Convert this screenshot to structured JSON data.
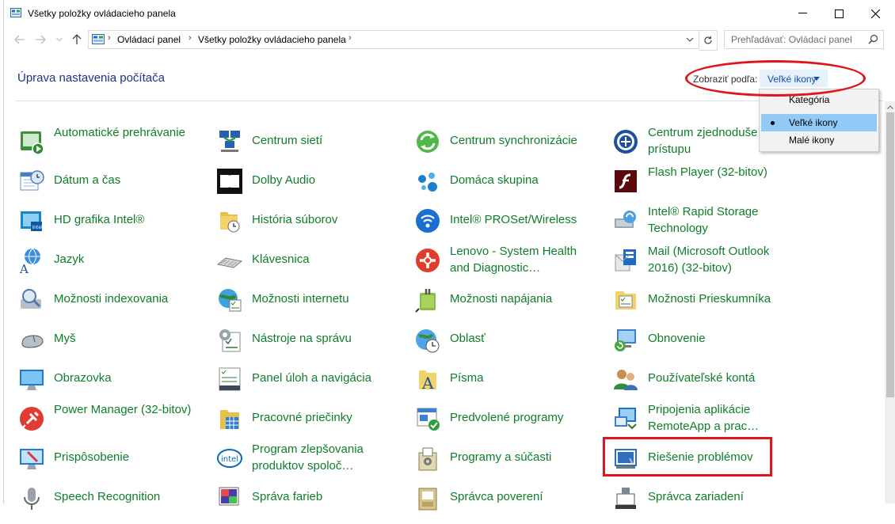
{
  "window": {
    "title": "Všetky položky ovládacieho panela"
  },
  "address": {
    "crumbs": [
      "Ovládací panel",
      "Všetky položky ovládacieho panela"
    ]
  },
  "search": {
    "placeholder": "Prehľadávať: Ovládací panel"
  },
  "header": {
    "title": "Úprava nastavenia počítača",
    "view_by_label": "Zobraziť podľa:",
    "view_by_value": "Veľké ikony"
  },
  "view_menu": {
    "options": [
      {
        "label": "Kategória",
        "selected": false
      },
      {
        "label": "Veľké ikony",
        "selected": true
      },
      {
        "label": "Malé ikony",
        "selected": false
      }
    ]
  },
  "colors": {
    "item_text": "#0f7e2a",
    "heading": "#1e3287",
    "annotation": "#e0141b",
    "menu_highlight": "#91c9f7"
  },
  "items": [
    {
      "label": "Automatické prehrávanie",
      "icon": "autoplay-icon"
    },
    {
      "label": "Centrum sietí",
      "icon": "network-center-icon"
    },
    {
      "label": "Centrum synchronizácie",
      "icon": "sync-center-icon"
    },
    {
      "label": "Centrum zjednodušeného prístupu",
      "icon": "ease-of-access-icon",
      "display": "Centrum zjednoduše… prístupu"
    },
    {
      "label": "Dátum a čas",
      "icon": "calendar-clock-icon"
    },
    {
      "label": "Dolby Audio",
      "icon": "dolby-icon"
    },
    {
      "label": "Domáca skupina",
      "icon": "homegroup-icon"
    },
    {
      "label": "Flash Player (32-bitov)",
      "icon": "flash-icon"
    },
    {
      "label": "HD grafika Intel®",
      "icon": "intel-graphics-icon"
    },
    {
      "label": "História súborov",
      "icon": "file-history-icon"
    },
    {
      "label": "Intel® PROSet/Wireless",
      "icon": "wireless-icon"
    },
    {
      "label": "Intel® Rapid Storage Technology",
      "icon": "storage-icon"
    },
    {
      "label": "Jazyk",
      "icon": "language-icon"
    },
    {
      "label": "Klávesnica",
      "icon": "keyboard-icon"
    },
    {
      "label": "Lenovo - System Health and Diagnostic…",
      "icon": "lenovo-health-icon"
    },
    {
      "label": "Mail (Microsoft Outlook 2016) (32-bitov)",
      "icon": "mail-icon"
    },
    {
      "label": "Možnosti indexovania",
      "icon": "indexing-icon"
    },
    {
      "label": "Možnosti internetu",
      "icon": "internet-options-icon"
    },
    {
      "label": "Možnosti napájania",
      "icon": "power-options-icon"
    },
    {
      "label": "Možnosti Prieskumníka",
      "icon": "explorer-options-icon"
    },
    {
      "label": "Myš",
      "icon": "mouse-icon"
    },
    {
      "label": "Nástroje na správu",
      "icon": "admin-tools-icon"
    },
    {
      "label": "Oblasť",
      "icon": "region-icon"
    },
    {
      "label": "Obnovenie",
      "icon": "recovery-icon"
    },
    {
      "label": "Obrazovka",
      "icon": "display-icon"
    },
    {
      "label": "Panel úloh a navigácia",
      "icon": "taskbar-icon"
    },
    {
      "label": "Písma",
      "icon": "fonts-icon"
    },
    {
      "label": "Používateľské kontá",
      "icon": "user-accounts-icon"
    },
    {
      "label": "Power Manager (32-bitov)",
      "icon": "power-manager-icon"
    },
    {
      "label": "Pracovné priečinky",
      "icon": "work-folders-icon"
    },
    {
      "label": "Predvolené programy",
      "icon": "default-programs-icon"
    },
    {
      "label": "Pripojenia aplikácie RemoteApp a prac…",
      "icon": "remoteapp-icon"
    },
    {
      "label": "Prispôsobenie",
      "icon": "personalization-icon"
    },
    {
      "label": "Program zlepšovania produktov spoloč…",
      "icon": "intel-program-icon"
    },
    {
      "label": "Programy a súčasti",
      "icon": "programs-features-icon"
    },
    {
      "label": "Riešenie problémov",
      "icon": "troubleshooting-icon"
    },
    {
      "label": "Speech Recognition",
      "icon": "speech-icon"
    },
    {
      "label": "Správa farieb",
      "icon": "color-management-icon"
    },
    {
      "label": "Správca poverení",
      "icon": "credential-manager-icon"
    },
    {
      "label": "Správca zariadení",
      "icon": "device-manager-icon"
    }
  ]
}
